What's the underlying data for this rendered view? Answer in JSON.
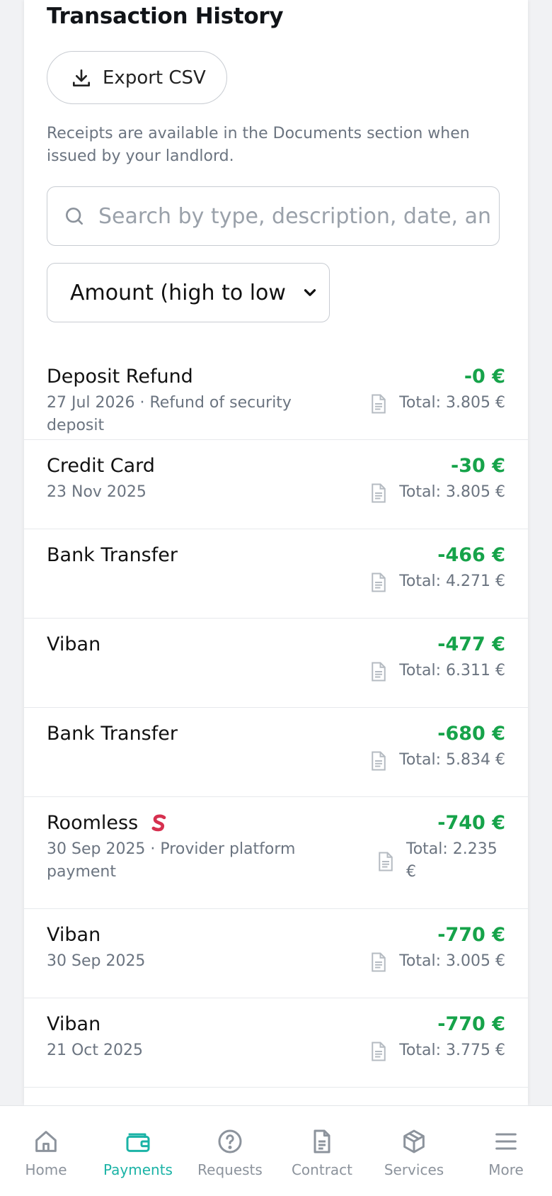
{
  "title": "Transaction History",
  "export_label": "Export CSV",
  "note": "Receipts are available in the Documents section when issued by your landlord.",
  "search": {
    "placeholder": "Search by type, description, date, an"
  },
  "sort": {
    "selected": "Amount (high to low"
  },
  "transactions": [
    {
      "name": "Deposit Refund",
      "amount": "-0 €",
      "sub": "27 Jul 2026 · Refund of security deposit",
      "total": "Total: 3.805 €"
    },
    {
      "name": "Credit Card",
      "amount": "-30 €",
      "sub": "23 Nov 2025",
      "total": "Total: 3.805 €"
    },
    {
      "name": "Bank Transfer",
      "amount": "-466 €",
      "sub": "",
      "total": "Total: 4.271 €"
    },
    {
      "name": "Viban",
      "amount": "-477 €",
      "sub": "",
      "total": "Total: 6.311 €"
    },
    {
      "name": "Bank Transfer",
      "amount": "-680 €",
      "sub": "",
      "total": "Total: 5.834 €"
    },
    {
      "name": "Roomless",
      "amount": "-740 €",
      "sub": "30 Sep 2025 · Provider platform payment",
      "total": "Total: 2.235 €",
      "badge": "s-logo-icon"
    },
    {
      "name": "Viban",
      "amount": "-770 €",
      "sub": "30 Sep 2025",
      "total": "Total: 3.005 €"
    },
    {
      "name": "Viban",
      "amount": "-770 €",
      "sub": "21 Oct 2025",
      "total": "Total: 3.775 €"
    }
  ],
  "nav": [
    {
      "label": "Home",
      "icon": "home-icon"
    },
    {
      "label": "Payments",
      "icon": "wallet-icon",
      "active": true
    },
    {
      "label": "Requests",
      "icon": "help-circle-icon"
    },
    {
      "label": "Contract",
      "icon": "document-icon"
    },
    {
      "label": "Services",
      "icon": "box-icon"
    },
    {
      "label": "More",
      "icon": "menu-icon"
    }
  ],
  "colors": {
    "accent": "#1bb3a6",
    "amount": "#16a34a",
    "badge": "#d6304f"
  }
}
